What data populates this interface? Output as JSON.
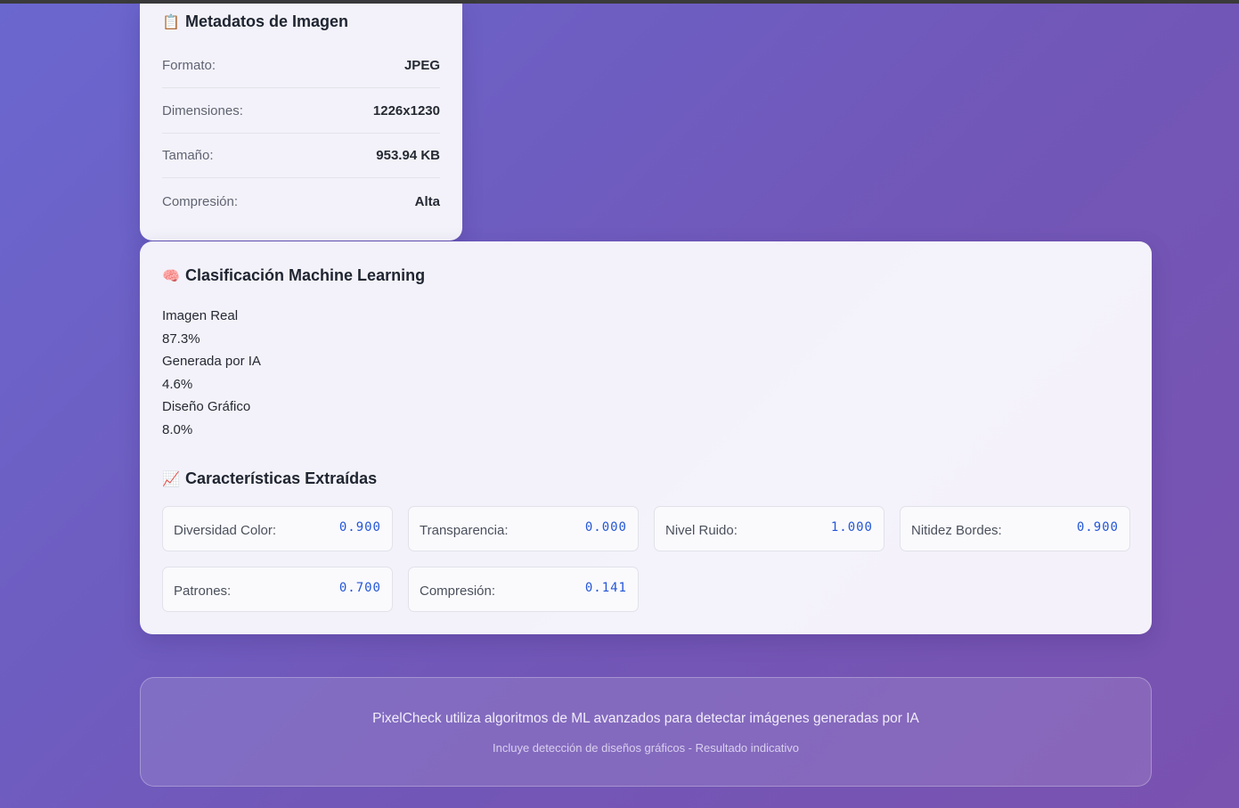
{
  "metadata": {
    "icon": "clipboard-icon",
    "title": "Metadatos de Imagen",
    "rows": [
      {
        "label": "Formato:",
        "value": "JPEG"
      },
      {
        "label": "Dimensiones:",
        "value": "1226x1230"
      },
      {
        "label": "Tamaño:",
        "value": "953.94 KB"
      },
      {
        "label": "Compresión:",
        "value": "Alta"
      }
    ]
  },
  "classification": {
    "icon": "brain-icon",
    "title": "Clasificación Machine Learning",
    "items": [
      {
        "label": "Imagen Real",
        "value": "87.3%"
      },
      {
        "label": "Generada por IA",
        "value": "4.6%"
      },
      {
        "label": "Diseño Gráfico",
        "value": "8.0%"
      }
    ]
  },
  "features": {
    "icon": "chart-increasing-icon",
    "title": "Características Extraídas",
    "items": [
      {
        "label": "Diversidad Color:",
        "value": "0.900"
      },
      {
        "label": "Transparencia:",
        "value": "0.000"
      },
      {
        "label": "Nivel Ruido:",
        "value": "1.000"
      },
      {
        "label": "Nitidez Bordes:",
        "value": "0.900"
      },
      {
        "label": "Patrones:",
        "value": "0.700"
      },
      {
        "label": "Compresión:",
        "value": "0.141"
      }
    ]
  },
  "footer": {
    "main": "PixelCheck utiliza algoritmos de ML avanzados para detectar imágenes generadas por IA",
    "sub": "Incluye detección de diseños gráficos - Resultado indicativo"
  },
  "colors": {
    "accent_value": "#2456d6",
    "background_start": "#6a67cf",
    "background_end": "#7a52b0"
  }
}
